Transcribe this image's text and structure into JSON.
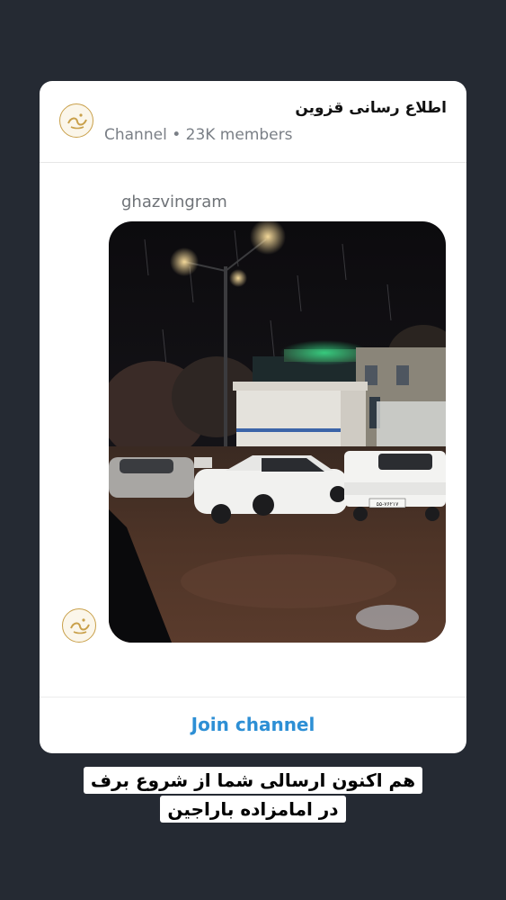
{
  "channel": {
    "title": "اطلاع رسانی قزوین",
    "meta": "Channel • 23K members",
    "avatar_icon": "qazvingram-logo-icon"
  },
  "post": {
    "sender": "ghazvingram",
    "photo": {
      "description_icon": "night-rain-street-photo",
      "plate_text": "۵۵-۷۶۲۱۷"
    }
  },
  "footer": {
    "join_label": "Join channel"
  },
  "caption": {
    "line1": "هم اکنون ارسالی شما از شروع برف",
    "line2": "در امامزاده باراجین"
  },
  "colors": {
    "background": "#252a33",
    "accent": "#2d8fd5",
    "logo_gold": "#c9a04a"
  }
}
